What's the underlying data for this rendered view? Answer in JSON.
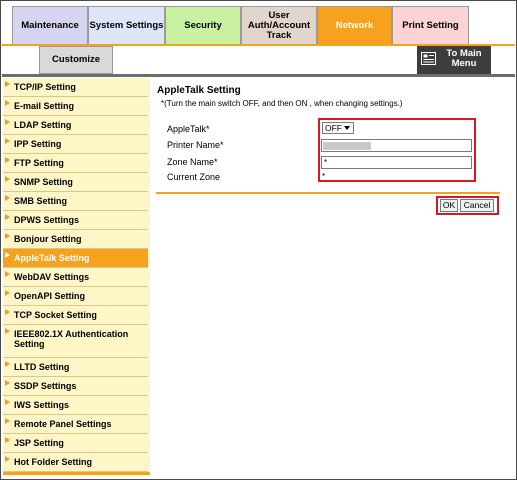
{
  "tabs": [
    {
      "label": "Maintenance",
      "bg": "#d5d5f2"
    },
    {
      "label": "System Settings",
      "bg": "#dde6f6"
    },
    {
      "label": "Security",
      "bg": "#c8f2a2"
    },
    {
      "label": "User Auth/Account Track",
      "bg": "#e2d6cc"
    },
    {
      "label": "Network",
      "bg": "#f7a21e"
    },
    {
      "label": "Print Setting",
      "bg": "#fbd3d5"
    }
  ],
  "subtab": {
    "label": "Customize"
  },
  "to_main": {
    "label": "To Main Menu",
    "icon": "menu-icon"
  },
  "sidebar": {
    "active_index": 9,
    "items": [
      {
        "label": "TCP/IP Setting"
      },
      {
        "label": "E-mail Setting"
      },
      {
        "label": "LDAP Setting"
      },
      {
        "label": "IPP Setting"
      },
      {
        "label": "FTP Setting"
      },
      {
        "label": "SNMP Setting"
      },
      {
        "label": "SMB Setting"
      },
      {
        "label": "DPWS Settings"
      },
      {
        "label": "Bonjour Setting"
      },
      {
        "label": "AppleTalk Setting"
      },
      {
        "label": "WebDAV Settings"
      },
      {
        "label": "OpenAPI Setting"
      },
      {
        "label": "TCP Socket Setting"
      },
      {
        "label": "IEEE802.1X Authentication Setting"
      },
      {
        "label": "LLTD Setting"
      },
      {
        "label": "SSDP Settings"
      },
      {
        "label": "IWS Settings"
      },
      {
        "label": "Remote Panel Settings"
      },
      {
        "label": "JSP Setting"
      },
      {
        "label": "Hot Folder Setting"
      }
    ]
  },
  "main": {
    "title": "AppleTalk Setting",
    "note": "*(Turn the main switch OFF, and then ON , when changing settings.)",
    "fields": {
      "appletalk": {
        "label": "AppleTalk*",
        "value": "OFF"
      },
      "printer_name": {
        "label": "Printer Name*",
        "value": ""
      },
      "zone_name": {
        "label": "Zone Name*",
        "value": "*"
      },
      "current_zone": {
        "label": "Current Zone",
        "value": "*"
      }
    },
    "ok_label": "OK",
    "cancel_label": "Cancel"
  },
  "colors": {
    "accent": "#f7a21e",
    "highlight_box": "#d61a20",
    "sidebar_bg": "#fff6c8",
    "to_main_bg": "#3d3d3d"
  }
}
